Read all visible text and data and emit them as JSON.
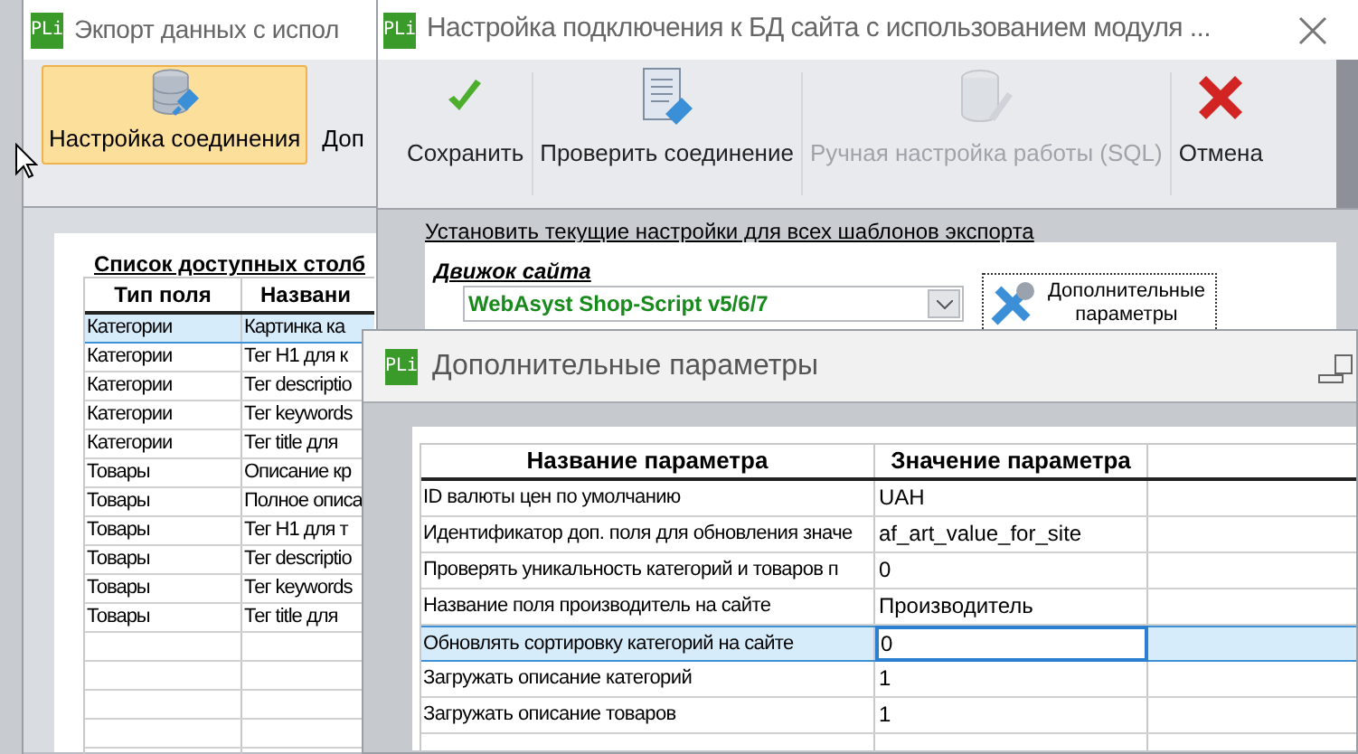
{
  "export_window": {
    "app_icon": "PLi",
    "title": "Экпорт данных с испол",
    "toolbar": [
      {
        "label": "Настройка соединения",
        "selected": true
      },
      {
        "label": "Доп",
        "selected": false
      }
    ],
    "table_title": "Список доступных столб",
    "columns": [
      "Тип поля",
      "Названи"
    ],
    "rows": [
      {
        "cells": [
          "Категории",
          "Картинка ка"
        ],
        "selected": true
      },
      {
        "cells": [
          "Категории",
          "Тег H1 для к"
        ],
        "selected": false
      },
      {
        "cells": [
          "Категории",
          "Тег descriptio"
        ],
        "selected": false
      },
      {
        "cells": [
          "Категории",
          "Тег keywords"
        ],
        "selected": false
      },
      {
        "cells": [
          "Категории",
          "Тег title для"
        ],
        "selected": false
      },
      {
        "cells": [
          "Товары",
          "Описание кр"
        ],
        "selected": false
      },
      {
        "cells": [
          "Товары",
          "Полное описа"
        ],
        "selected": false
      },
      {
        "cells": [
          "Товары",
          "Тег H1 для т"
        ],
        "selected": false
      },
      {
        "cells": [
          "Товары",
          "Тег descriptio"
        ],
        "selected": false
      },
      {
        "cells": [
          "Товары",
          "Тег keywords"
        ],
        "selected": false
      },
      {
        "cells": [
          "Товары",
          "Тег title для"
        ],
        "selected": false
      }
    ]
  },
  "connection_window": {
    "app_icon": "PLi",
    "title": "Настройка подключения к БД сайта с использованием модуля ...",
    "toolbar": [
      {
        "kind": "save",
        "label": "Сохранить",
        "disabled": false
      },
      {
        "kind": "check",
        "label": "Проверить соединение",
        "disabled": false
      },
      {
        "kind": "sql",
        "label": "Ручная настройка работы (SQL)",
        "disabled": true
      },
      {
        "kind": "cancel",
        "label": "Отмена",
        "disabled": false
      }
    ],
    "apply_link": "Установить текущие настройки для всех шаблонов экспорта",
    "engine_label": "Движок сайта",
    "engine_value": "WebAsyst Shop-Script v5/6/7",
    "extra_button": "Дополнительные параметры"
  },
  "params_dialog": {
    "app_icon": "PLi",
    "title": "Дополнительные параметры",
    "columns": [
      "Название параметра",
      "Значение параметра"
    ],
    "rows": [
      {
        "name": "ID валюты цен по умолчанию",
        "value": "UAH",
        "selected": false
      },
      {
        "name": "Идентификатор доп. поля для обновления значе",
        "value": "af_art_value_for_site",
        "selected": false
      },
      {
        "name": "Проверять уникальность категорий и товаров п",
        "value": "0",
        "selected": false
      },
      {
        "name": "Название поля производитель на сайте",
        "value": "Производитель",
        "selected": false
      },
      {
        "name": "Обновлять сортировку категорий на сайте",
        "value": "0",
        "selected": true
      },
      {
        "name": "Загружать описание категорий",
        "value": "1",
        "selected": false
      },
      {
        "name": "Загружать описание товаров",
        "value": "1",
        "selected": false
      }
    ]
  }
}
